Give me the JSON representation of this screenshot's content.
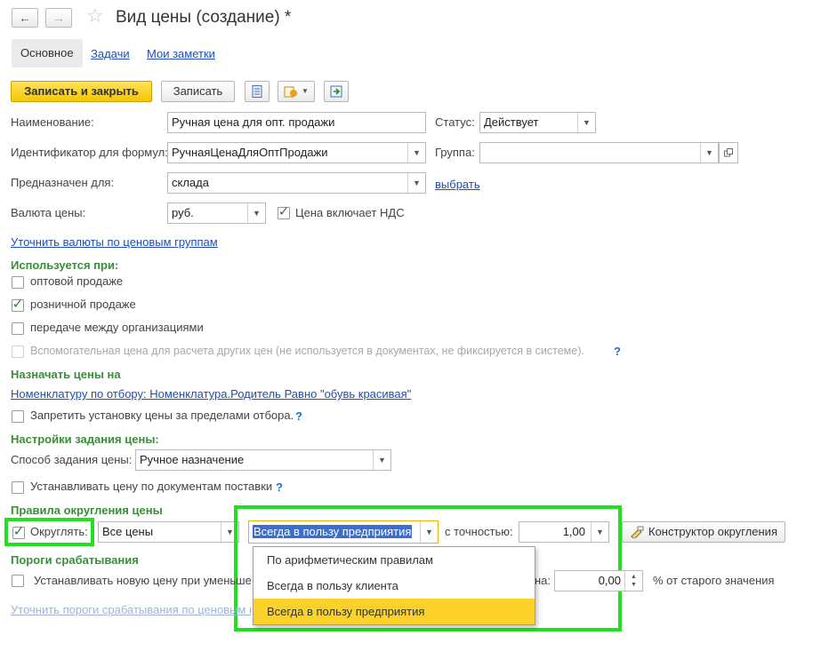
{
  "header": {
    "title": "Вид цены (создание) *",
    "back_icon": "arrow-left-icon",
    "forward_icon": "arrow-right-icon",
    "favorite_icon": "star-icon"
  },
  "tabs": [
    {
      "label": "Основное"
    },
    {
      "label": "Задачи"
    },
    {
      "label": "Мои заметки"
    }
  ],
  "toolbar": {
    "save_close": "Записать и закрыть",
    "save": "Записать"
  },
  "form": {
    "name_label": "Наименование:",
    "name_value": "Ручная цена для опт. продажи",
    "status_label": "Статус:",
    "status_value": "Действует",
    "formula_id_label": "Идентификатор для формул:",
    "formula_id_value": "РучнаяЦенаДляОптПродажи",
    "group_label": "Группа:",
    "group_value": "",
    "intended_label": "Предназначен для:",
    "intended_value": "склада",
    "choose_link": "выбрать",
    "currency_label": "Валюта цены:",
    "currency_value": "руб.",
    "vat_label": "Цена включает НДС",
    "refine_currency_link": "Уточнить валюты по ценовым группам"
  },
  "used_in": {
    "title": "Используется при:",
    "wholesale": "оптовой продаже",
    "retail": "розничной продаже",
    "transfer": "передаче между организациями",
    "auxiliary": "Вспомогательная цена для расчета других цен (не используется в документах, не фиксируется в системе).",
    "help": "?"
  },
  "assign": {
    "title": "Назначать цены на",
    "filter_link": "Номенклатуру по отбору: Номенклатура.Родитель Равно \"обувь красивая\"",
    "forbid_label": "Запретить установку цены за пределами отбора.",
    "help": "?"
  },
  "price_settings": {
    "title": "Настройки задания цены:",
    "method_label": "Способ задания цены:",
    "method_value": "Ручное назначение",
    "by_docs_label": "Устанавливать цену по документам поставки",
    "help": "?"
  },
  "rounding": {
    "title": "Правила округления цены",
    "round_label": "Округлять:",
    "scope_value": "Все цены",
    "mode_value": "Всегда в пользу предприятия",
    "precision_label": "с точностью:",
    "precision_value": "1,00",
    "constructor_button": "Конструктор округления",
    "options": [
      {
        "label": "По арифметическим правилам"
      },
      {
        "label": "Всегда в пользу клиента"
      },
      {
        "label": "Всегда в пользу предприятия"
      }
    ]
  },
  "thresholds": {
    "title": "Пороги срабатывания",
    "new_price_label": "Устанавливать новую цену при уменьше",
    "partial_label": "на:",
    "percent_value": "0,00",
    "percent_suffix": "% от старого значения",
    "refine_link": "Уточнить пороги срабатывания по ценовым г"
  },
  "colors": {
    "accent_green": "#22e01f",
    "primary_yellow": "#f5c600",
    "link_blue": "#1f4fb0",
    "section_green": "#3a8d3a"
  }
}
